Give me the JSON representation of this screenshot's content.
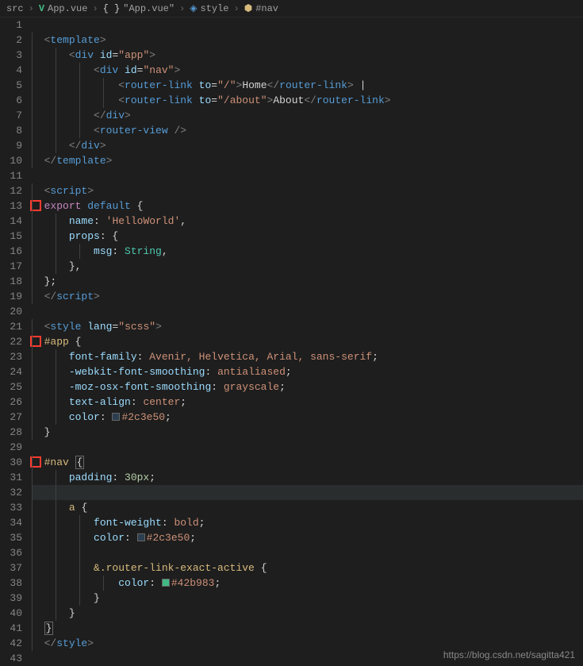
{
  "breadcrumbs": {
    "src": "src",
    "file": "App.vue",
    "json": "\"App.vue\"",
    "style": "style",
    "nav": "#nav"
  },
  "lines": {
    "l2": {
      "tag_o": "<",
      "tagname": "template",
      "tag_c": ">"
    },
    "l3": {
      "tag_o": "<",
      "tagname": "div",
      "sp": " ",
      "attr": "id",
      "eq": "=",
      "str": "\"app\"",
      "tag_c": ">"
    },
    "l4": {
      "tag_o": "<",
      "tagname": "div",
      "sp": " ",
      "attr": "id",
      "eq": "=",
      "str": "\"nav\"",
      "tag_c": ">"
    },
    "l5": {
      "tag_o": "<",
      "tagname": "router-link",
      "sp": " ",
      "attr": "to",
      "eq": "=",
      "str": "\"/\"",
      "tag_c": ">",
      "text": "Home",
      "ctag_o": "</",
      "ctagname": "router-link",
      "ctag_c": ">",
      "pipe": " |"
    },
    "l6": {
      "tag_o": "<",
      "tagname": "router-link",
      "sp": " ",
      "attr": "to",
      "eq": "=",
      "str": "\"/about\"",
      "tag_c": ">",
      "text": "About",
      "ctag_o": "</",
      "ctagname": "router-link",
      "ctag_c": ">"
    },
    "l7": {
      "tag_o": "</",
      "tagname": "div",
      "tag_c": ">"
    },
    "l8": {
      "tag_o": "<",
      "tagname": "router-view",
      "sp": " ",
      "tag_c": "/>"
    },
    "l9": {
      "tag_o": "</",
      "tagname": "div",
      "tag_c": ">"
    },
    "l10": {
      "tag_o": "</",
      "tagname": "template",
      "tag_c": ">"
    },
    "l12": {
      "tag_o": "<",
      "tagname": "script",
      "tag_c": ">"
    },
    "l13": {
      "kw": "export",
      "sp": " ",
      "kw2": "default",
      "sp2": " ",
      "brace": "{"
    },
    "l14": {
      "prop": "name",
      "punct": ": ",
      "str": "'HelloWorld'",
      "comma": ","
    },
    "l15": {
      "prop": "props",
      "punct": ": {",
      "comma": ""
    },
    "l16": {
      "prop": "msg",
      "punct": ": ",
      "type": "String",
      "comma": ","
    },
    "l17": {
      "brace": "},"
    },
    "l18": {
      "brace": "};"
    },
    "l19": {
      "tag_o": "</",
      "tagname": "script",
      "tag_c": ">"
    },
    "l21": {
      "tag_o": "<",
      "tagname": "style",
      "sp": " ",
      "attr": "lang",
      "eq": "=",
      "str": "\"scss\"",
      "tag_c": ">"
    },
    "l22": {
      "sel": "#app",
      "sp": " ",
      "brace": "{"
    },
    "l23": {
      "prop": "font-family",
      "punct": ": ",
      "val": "Avenir, Helvetica, Arial, sans-serif",
      "semi": ";"
    },
    "l24": {
      "prop": "-webkit-font-smoothing",
      "punct": ": ",
      "val": "antialiased",
      "semi": ";"
    },
    "l25": {
      "prop": "-moz-osx-font-smoothing",
      "punct": ": ",
      "val": "grayscale",
      "semi": ";"
    },
    "l26": {
      "prop": "text-align",
      "punct": ": ",
      "val": "center",
      "semi": ";"
    },
    "l27": {
      "prop": "color",
      "punct": ": ",
      "val": "#2c3e50",
      "semi": ";"
    },
    "l28": {
      "brace": "}"
    },
    "l30": {
      "sel": "#nav",
      "sp": " ",
      "brace": "{"
    },
    "l31": {
      "prop": "padding",
      "punct": ": ",
      "val": "30px",
      "semi": ";"
    },
    "l33": {
      "sel": "a",
      "sp": " ",
      "brace": "{"
    },
    "l34": {
      "prop": "font-weight",
      "punct": ": ",
      "val": "bold",
      "semi": ";"
    },
    "l35": {
      "prop": "color",
      "punct": ": ",
      "val": "#2c3e50",
      "semi": ";"
    },
    "l37": {
      "amp": "&",
      "sel": ".router-link-exact-active",
      "sp": " ",
      "brace": "{"
    },
    "l38": {
      "prop": "color",
      "punct": ": ",
      "val": "#42b983",
      "semi": ";"
    },
    "l39": {
      "brace": "}"
    },
    "l40": {
      "brace": "}"
    },
    "l41": {
      "brace": "}"
    },
    "l42": {
      "tag_o": "</",
      "tagname": "style",
      "tag_c": ">"
    }
  },
  "colors": {
    "c1": "#2c3e50",
    "c2": "#42b983"
  },
  "watermark": "https://blog.csdn.net/sagitta421"
}
